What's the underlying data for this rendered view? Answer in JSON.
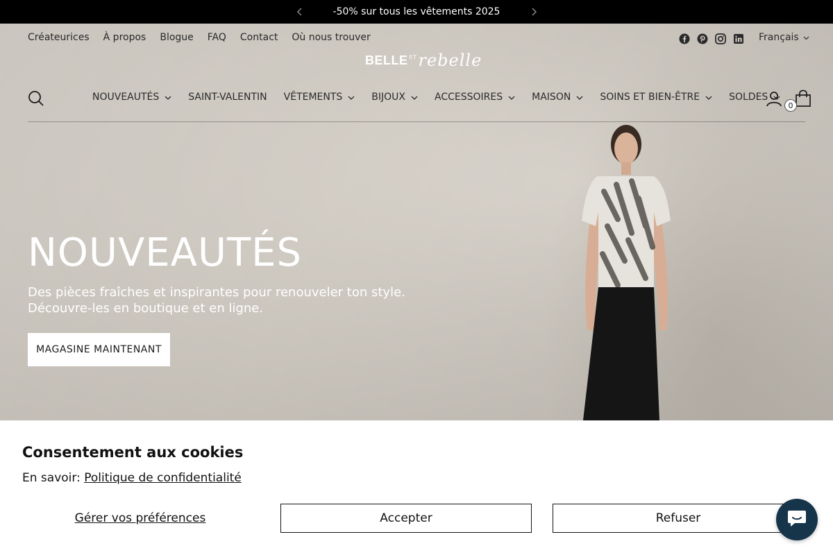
{
  "announcement": {
    "text": "-50% sur tous les vêtements 2025"
  },
  "utility_links": [
    "Créateurices",
    "À propos",
    "Blogue",
    "FAQ",
    "Contact",
    "Où nous trouver"
  ],
  "socials": [
    "facebook-icon",
    "pinterest-icon",
    "instagram-icon",
    "linkedin-icon"
  ],
  "language": {
    "selected": "Français"
  },
  "logo": {
    "part1": "BELLE",
    "part2": "ET",
    "part3": "rebelle"
  },
  "nav": [
    {
      "label": "NOUVEAUTÉS",
      "dropdown": true
    },
    {
      "label": "SAINT-VALENTIN",
      "dropdown": false
    },
    {
      "label": "VÊTEMENTS",
      "dropdown": true
    },
    {
      "label": "BIJOUX",
      "dropdown": true
    },
    {
      "label": "ACCESSOIRES",
      "dropdown": true
    },
    {
      "label": "MAISON",
      "dropdown": true
    },
    {
      "label": "SOINS ET BIEN-ÊTRE",
      "dropdown": true
    },
    {
      "label": "SOLDES",
      "dropdown": true
    }
  ],
  "cart": {
    "count": "0"
  },
  "hero": {
    "title": "NOUVEAUTÉS",
    "subtitle_line1": "Des pièces fraîches et inspirantes pour renouveler ton style.",
    "subtitle_line2": "Découvre-les en boutique et en ligne.",
    "cta": "MAGASINE MAINTENANT"
  },
  "cookie": {
    "title": "Consentement aux cookies",
    "learn_prefix": "En savoir:",
    "privacy_link": "Politique de confidentialité",
    "preferences": "Gérer vos préférences",
    "accept": "Accepter",
    "refuse": "Refuser"
  },
  "colors": {
    "announcement_bg": "#000000",
    "chat_bg": "#16344a",
    "text": "#1a1a1a"
  }
}
